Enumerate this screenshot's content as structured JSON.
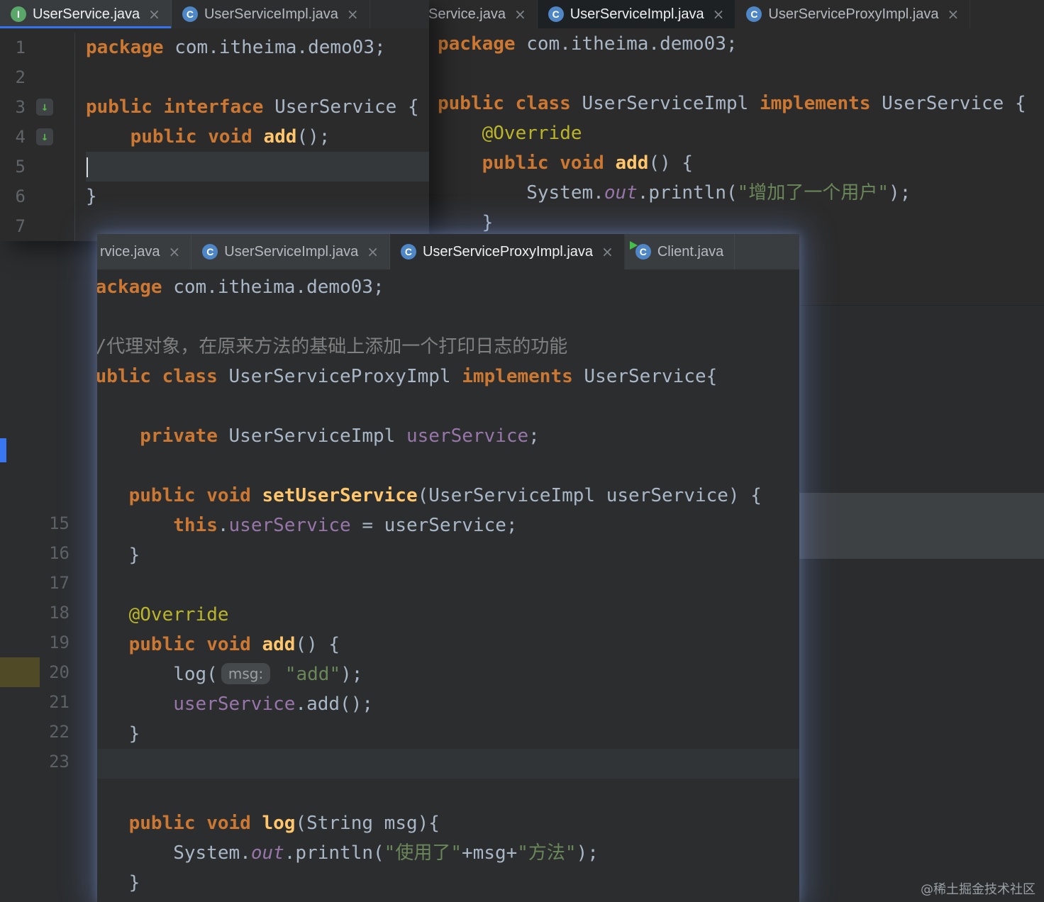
{
  "watermark": "@稀土掘金技术社区",
  "colors": {
    "accent_blue": "#3574f0",
    "keyword_orange": "#cc7832",
    "string_green": "#6a8759",
    "method_yellow": "#ffc66b",
    "field_purple": "#9876aa",
    "annotation_yellow": "#bbb529",
    "run_green": "#43c04a",
    "editor_bg": "#2b2b2b"
  },
  "ui": {
    "close_glyph": "×",
    "gutter_marker_glyph": "↓"
  },
  "background": {
    "line_numbers": [
      "15",
      "16",
      "17",
      "18",
      "19",
      "20",
      "21",
      "22",
      "23"
    ]
  },
  "windows": {
    "top_left": {
      "tabs": [
        {
          "label": "UserService.java",
          "icon": "interface",
          "active": true,
          "close": true
        },
        {
          "label": "UserServiceImpl.java",
          "icon": "class",
          "close": true
        }
      ],
      "gutter": {
        "numbers": [
          "1",
          "2",
          "3",
          "4",
          "5",
          "6",
          "7"
        ],
        "icon_lines": [
          3,
          4
        ]
      },
      "code": {
        "active_line": 5,
        "caret_line": 5,
        "lines": [
          [
            [
              "kw",
              "package"
            ],
            [
              "def",
              " com.itheima.demo03;"
            ]
          ],
          [],
          [
            [
              "kw",
              "public interface"
            ],
            [
              "def",
              " UserService {"
            ]
          ],
          [
            [
              "def",
              "    "
            ],
            [
              "kw",
              "public void "
            ],
            [
              "mth",
              "add"
            ],
            [
              "def",
              "();"
            ]
          ],
          [],
          [
            [
              "def",
              "}"
            ]
          ],
          []
        ]
      }
    },
    "top_right": {
      "tabs": [
        {
          "label": "Service.java",
          "partial": true,
          "close": true
        },
        {
          "label": "UserServiceImpl.java",
          "icon": "class",
          "active": true,
          "close": true
        },
        {
          "label": "UserServiceProxyImpl.java",
          "icon": "class",
          "close": true
        }
      ],
      "code": {
        "lines": [
          [
            [
              "kw",
              "package"
            ],
            [
              "def",
              " com.itheima.demo03;"
            ]
          ],
          [],
          [
            [
              "kw",
              "public class"
            ],
            [
              "def",
              " UserServiceImpl "
            ],
            [
              "kw",
              "implements"
            ],
            [
              "def",
              " UserService {"
            ]
          ],
          [
            [
              "def",
              "    "
            ],
            [
              "ann",
              "@Override"
            ]
          ],
          [
            [
              "def",
              "    "
            ],
            [
              "kw",
              "public void "
            ],
            [
              "mth",
              "add"
            ],
            [
              "def",
              "() {"
            ]
          ],
          [
            [
              "def",
              "        System."
            ],
            [
              "fldi",
              "out"
            ],
            [
              "def",
              ".println("
            ],
            [
              "str",
              "\"增加了一个用户\""
            ],
            [
              "def",
              ");"
            ]
          ],
          [
            [
              "def",
              "    }"
            ]
          ]
        ]
      }
    },
    "front": {
      "tabs": [
        {
          "label": "rvice.java",
          "partial": true,
          "close": true
        },
        {
          "label": "UserServiceImpl.java",
          "icon": "class",
          "close": true
        },
        {
          "label": "UserServiceProxyImpl.java",
          "icon": "class",
          "active": true,
          "close": true
        },
        {
          "label": "Client.java",
          "icon": "class",
          "run": true
        }
      ],
      "code": {
        "active_line": 17,
        "lines": [
          [
            [
              "kw",
              "package"
            ],
            [
              "def",
              " com.itheima.demo03;"
            ]
          ],
          [],
          [
            [
              "com",
              "//代理对象，在原来方法的基础上添加一个打印日志的功能"
            ]
          ],
          [
            [
              "kw",
              "public class"
            ],
            [
              "def",
              " UserServiceProxyImpl "
            ],
            [
              "kw",
              "implements"
            ],
            [
              "def",
              " UserService{"
            ]
          ],
          [],
          [
            [
              "def",
              "     "
            ],
            [
              "kw",
              "private"
            ],
            [
              "def",
              " UserServiceImpl "
            ],
            [
              "fld",
              "userService"
            ],
            [
              "def",
              ";"
            ]
          ],
          [],
          [
            [
              "def",
              "    "
            ],
            [
              "kw",
              "public void "
            ],
            [
              "mth",
              "setUserService"
            ],
            [
              "def",
              "(UserServiceImpl userService) {"
            ]
          ],
          [
            [
              "def",
              "        "
            ],
            [
              "kw",
              "this"
            ],
            [
              "def",
              "."
            ],
            [
              "fld",
              "userService"
            ],
            [
              "def",
              " = userService;"
            ]
          ],
          [
            [
              "def",
              "    }"
            ]
          ],
          [],
          [
            [
              "def",
              "    "
            ],
            [
              "ann",
              "@Override"
            ]
          ],
          [
            [
              "def",
              "    "
            ],
            [
              "kw",
              "public void "
            ],
            [
              "mth",
              "add"
            ],
            [
              "def",
              "() {"
            ]
          ],
          [
            [
              "def",
              "        log("
            ],
            [
              "hint",
              "msg:"
            ],
            [
              "def",
              " "
            ],
            [
              "str",
              "\"add\""
            ],
            [
              "def",
              ");"
            ]
          ],
          [
            [
              "def",
              "        "
            ],
            [
              "fld",
              "userService"
            ],
            [
              "def",
              ".add();"
            ]
          ],
          [
            [
              "def",
              "    }"
            ]
          ],
          [],
          [],
          [
            [
              "def",
              "    "
            ],
            [
              "kw",
              "public void "
            ],
            [
              "mth",
              "log"
            ],
            [
              "def",
              "(String msg){"
            ]
          ],
          [
            [
              "def",
              "        System."
            ],
            [
              "fldi",
              "out"
            ],
            [
              "def",
              ".println("
            ],
            [
              "str",
              "\"使用了\""
            ],
            [
              "def",
              "+msg+"
            ],
            [
              "str",
              "\"方法\""
            ],
            [
              "def",
              ");"
            ]
          ],
          [
            [
              "def",
              "    }"
            ]
          ]
        ]
      }
    }
  }
}
